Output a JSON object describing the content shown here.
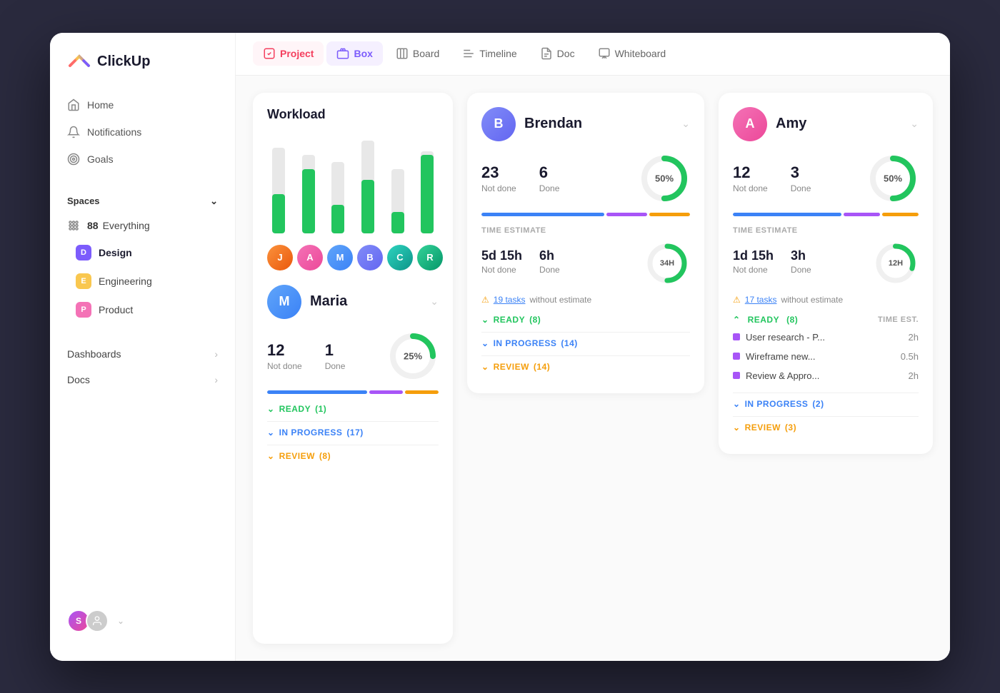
{
  "app": {
    "name": "ClickUp"
  },
  "sidebar": {
    "nav": [
      {
        "id": "home",
        "label": "Home",
        "icon": "home"
      },
      {
        "id": "notifications",
        "label": "Notifications",
        "icon": "bell"
      },
      {
        "id": "goals",
        "label": "Goals",
        "icon": "trophy"
      }
    ],
    "spaces_label": "Spaces",
    "spaces": [
      {
        "id": "everything",
        "label": "Everything",
        "count": "88",
        "type": "dots"
      },
      {
        "id": "design",
        "label": "Design",
        "badge": "D",
        "badge_color": "purple",
        "active": true
      },
      {
        "id": "engineering",
        "label": "Engineering",
        "badge": "E",
        "badge_color": "yellow"
      },
      {
        "id": "product",
        "label": "Product",
        "badge": "P",
        "badge_color": "pink"
      }
    ],
    "sections": [
      {
        "id": "dashboards",
        "label": "Dashboards"
      },
      {
        "id": "docs",
        "label": "Docs"
      }
    ],
    "footer": {
      "user1_initial": "S",
      "user2_initial": ""
    }
  },
  "topbar": {
    "tabs": [
      {
        "id": "project",
        "label": "Project",
        "active": true,
        "icon": "cube"
      },
      {
        "id": "box",
        "label": "Box",
        "icon": "box"
      },
      {
        "id": "board",
        "label": "Board",
        "icon": "board"
      },
      {
        "id": "timeline",
        "label": "Timeline",
        "icon": "timeline"
      },
      {
        "id": "doc",
        "label": "Doc",
        "icon": "doc"
      },
      {
        "id": "whiteboard",
        "label": "Whiteboard",
        "icon": "whiteboard"
      }
    ]
  },
  "workload": {
    "title": "Workload",
    "bars": [
      {
        "height_bg": 120,
        "height_fill": 55
      },
      {
        "height_bg": 110,
        "height_fill": 90
      },
      {
        "height_bg": 100,
        "height_fill": 40
      },
      {
        "height_bg": 130,
        "height_fill": 75
      },
      {
        "height_bg": 90,
        "height_fill": 30
      },
      {
        "height_bg": 115,
        "height_fill": 110
      }
    ],
    "avatars": [
      "av-orange",
      "av-pink",
      "av-blue",
      "av-indigo",
      "av-teal",
      "av-green"
    ]
  },
  "brendan": {
    "name": "Brendan",
    "not_done": "23",
    "done": "6",
    "not_done_label": "Not done",
    "done_label": "Done",
    "percent": "50%",
    "percent_num": 50,
    "time_estimate_label": "TIME ESTIMATE",
    "time_not_done": "5d 15h",
    "time_done": "6h",
    "donut_label": "34H",
    "warning_text": "19 tasks",
    "warning_suffix": " without estimate",
    "ready_label": "READY",
    "ready_count": "(8)",
    "inprogress_label": "IN PROGRESS",
    "inprogress_count": "(14)",
    "review_label": "REVIEW",
    "review_count": "(14)"
  },
  "maria": {
    "name": "Maria",
    "not_done": "12",
    "done": "1",
    "not_done_label": "Not done",
    "done_label": "Done",
    "percent": "25%",
    "percent_num": 25,
    "ready_label": "READY",
    "ready_count": "(1)",
    "inprogress_label": "IN PROGRESS",
    "inprogress_count": "(17)",
    "review_label": "REVIEW",
    "review_count": "(8)"
  },
  "amy": {
    "name": "Amy",
    "not_done": "12",
    "done": "3",
    "not_done_label": "Not done",
    "done_label": "Done",
    "percent": "50%",
    "percent_num": 50,
    "time_estimate_label": "TIME ESTIMATE",
    "time_not_done": "1d 15h",
    "time_done": "3h",
    "donut_label": "12H",
    "warning_text": "17 tasks",
    "warning_suffix": " without estimate",
    "ready_label": "READY",
    "ready_count": "(8)",
    "time_est_col": "TIME EST.",
    "inprogress_label": "IN PROGRESS",
    "inprogress_count": "(2)",
    "review_label": "REVIEW",
    "review_count": "(3)",
    "tasks": [
      {
        "name": "User research - P...",
        "time": "2h"
      },
      {
        "name": "Wireframe new...",
        "time": "0.5h"
      },
      {
        "name": "Review & Appro...",
        "time": "2h"
      }
    ]
  }
}
